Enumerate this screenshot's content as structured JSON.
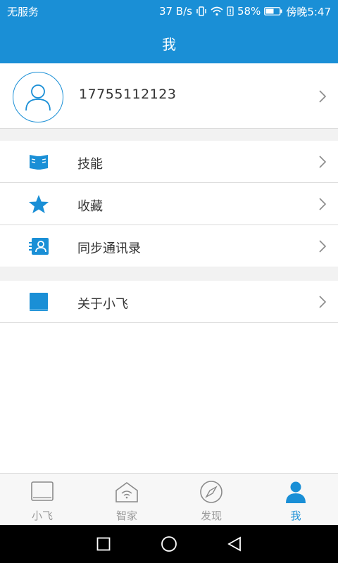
{
  "status_bar": {
    "carrier": "无服务",
    "speed": "37 B/s",
    "battery": "58%",
    "time": "傍晚5:47",
    "icons": [
      "vibrate-icon",
      "wifi-icon",
      "alert-icon",
      "battery-icon"
    ]
  },
  "header": {
    "title": "我"
  },
  "profile": {
    "phone": "17755112123",
    "avatar_icon": "user-avatar-icon"
  },
  "menu": {
    "items": [
      {
        "label": "技能",
        "icon": "book-icon"
      },
      {
        "label": "收藏",
        "icon": "star-icon"
      },
      {
        "label": "同步通讯录",
        "icon": "contacts-icon"
      },
      {
        "label": "关于小飞",
        "icon": "square-icon"
      }
    ]
  },
  "tabs": [
    {
      "label": "小飞",
      "icon": "device-icon",
      "active": false
    },
    {
      "label": "智家",
      "icon": "smart-home-icon",
      "active": false
    },
    {
      "label": "发现",
      "icon": "compass-icon",
      "active": false
    },
    {
      "label": "我",
      "icon": "person-icon",
      "active": true
    }
  ],
  "colors": {
    "accent": "#1a8fd6",
    "text": "#333333",
    "muted": "#9a9a9a",
    "divider": "#dcdcdc"
  }
}
